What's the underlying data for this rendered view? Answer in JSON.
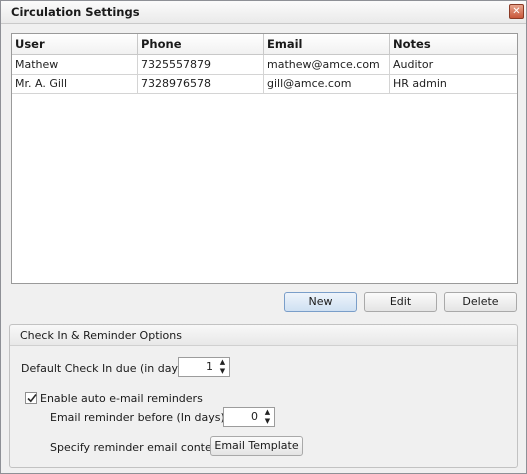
{
  "window": {
    "title": "Circulation Settings",
    "close_symbol": "✕"
  },
  "table": {
    "columns": [
      "User",
      "Phone",
      "Email",
      "Notes"
    ],
    "rows": [
      [
        "Mathew",
        "7325557879",
        "mathew@amce.com",
        "Auditor"
      ],
      [
        "Mr. A. Gill",
        "7328976578",
        "gill@amce.com",
        "HR admin"
      ]
    ]
  },
  "actions": {
    "new_label": "New",
    "edit_label": "Edit",
    "delete_label": "Delete"
  },
  "options": {
    "group_title": "Check In & Reminder Options",
    "checkin_label": "Default Check In due (in days):",
    "checkin_value": "1",
    "enable_reminders_label": "Enable auto e-mail reminders",
    "enable_reminders_checked": true,
    "reminder_before_label": "Email reminder before (In days):",
    "reminder_before_value": "0",
    "content_label": "Specify reminder email content:",
    "template_button_label": "Email Template"
  }
}
